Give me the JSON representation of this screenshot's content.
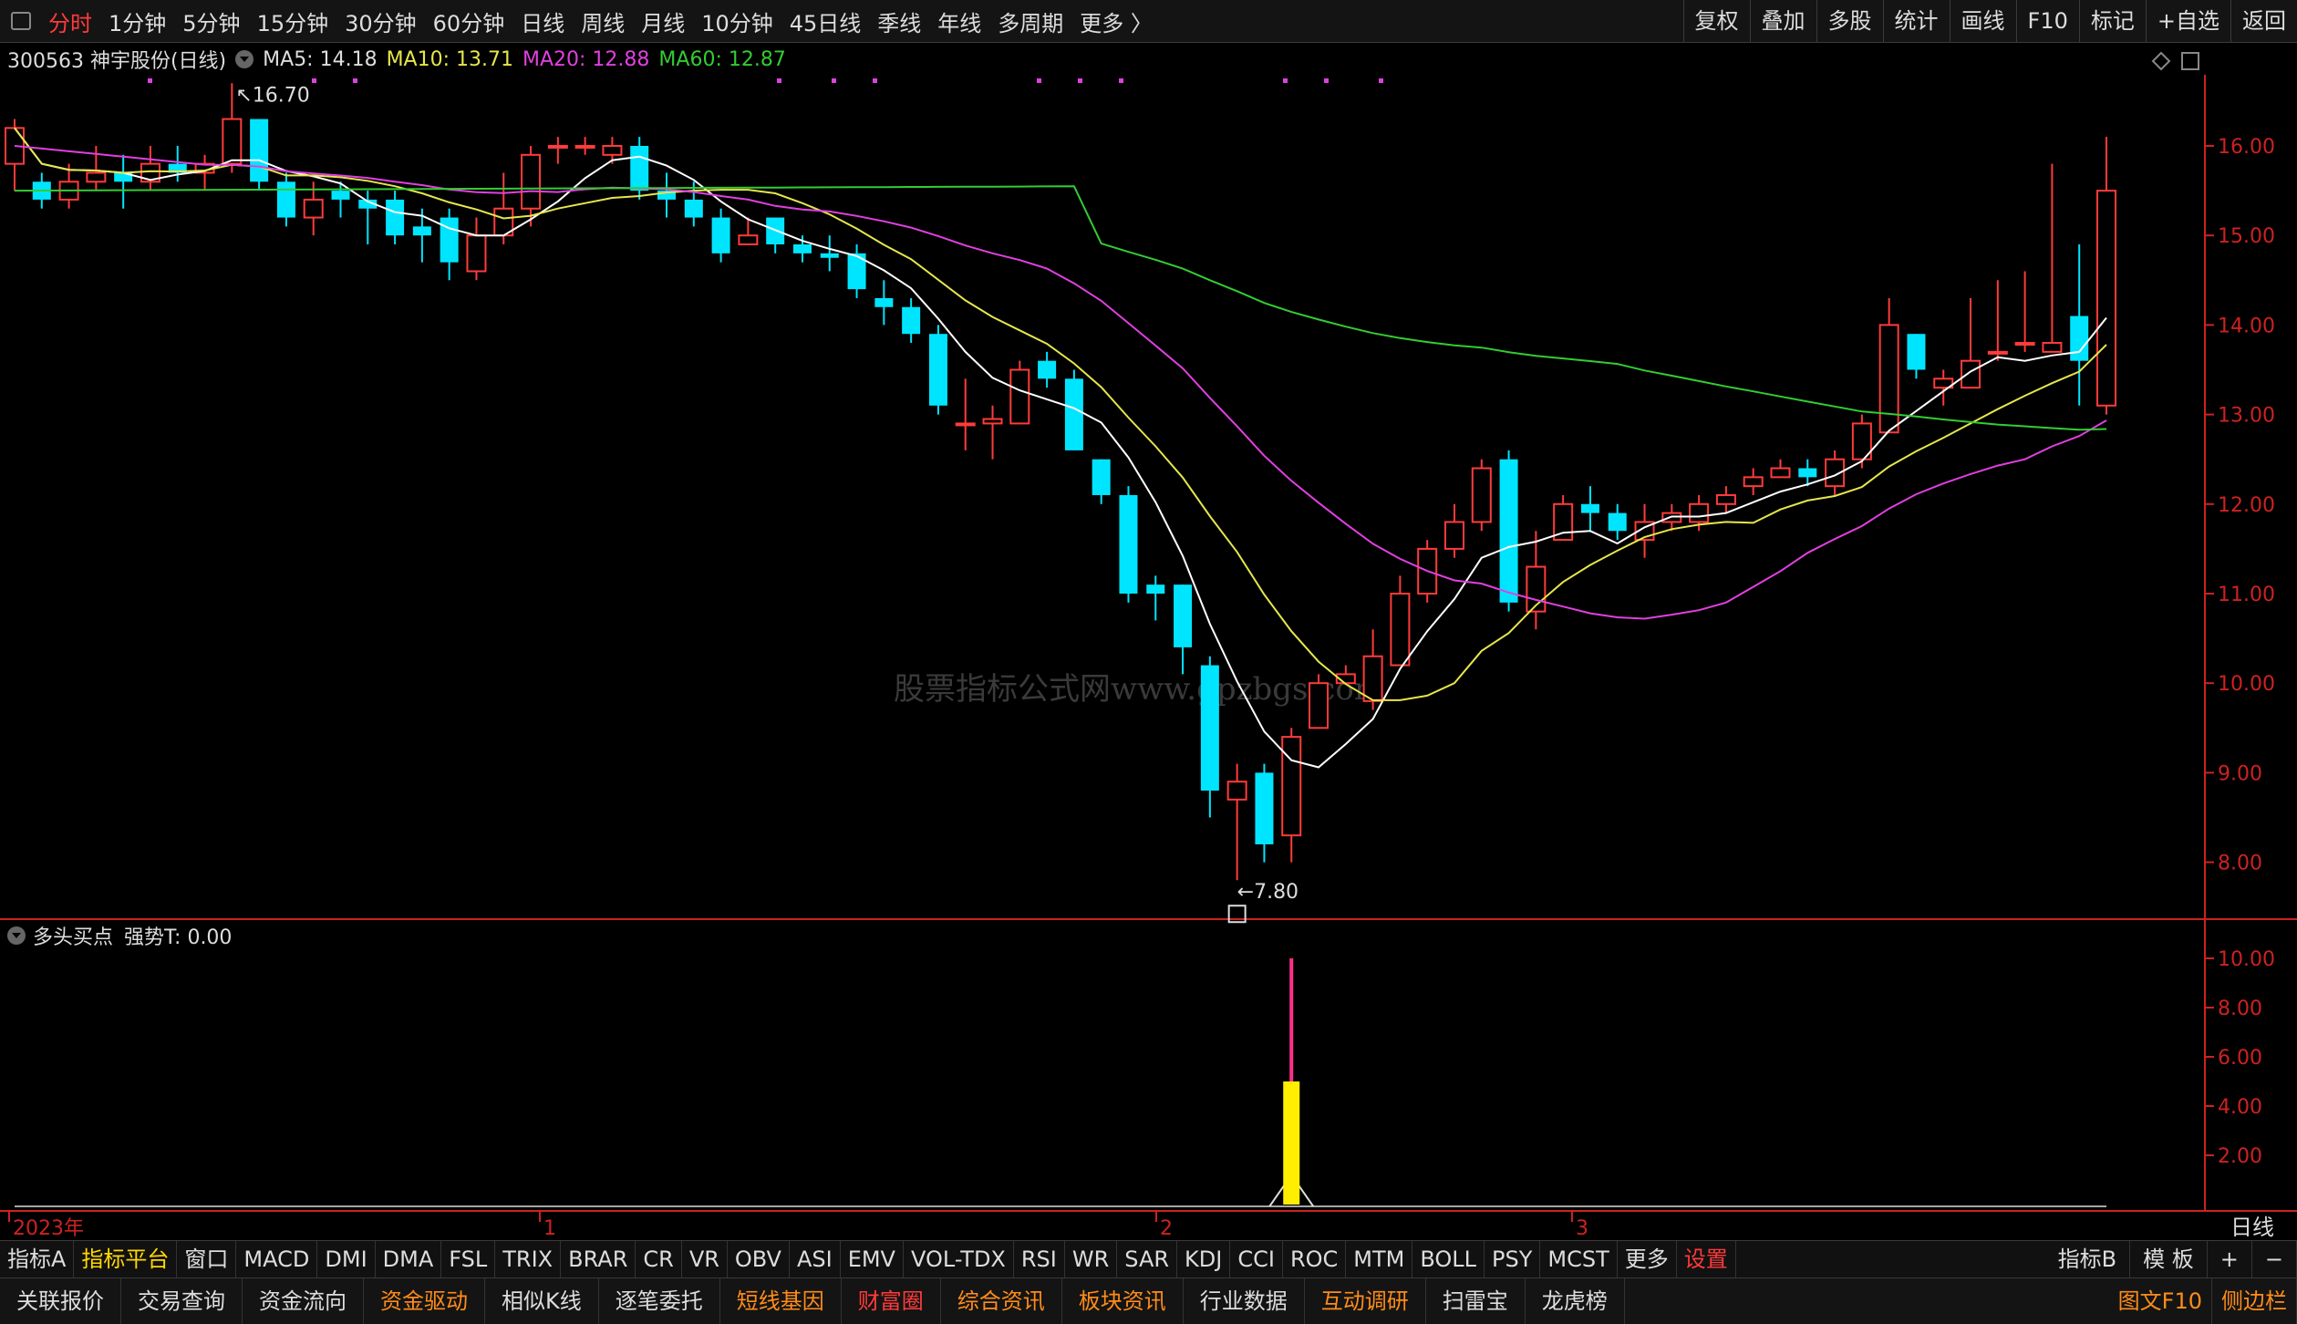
{
  "topbar": {
    "periods": [
      "分时",
      "1分钟",
      "5分钟",
      "15分钟",
      "30分钟",
      "60分钟",
      "日线",
      "周线",
      "月线",
      "10分钟",
      "45日线",
      "季线",
      "年线",
      "多周期",
      "更多 〉"
    ],
    "active_index": 0,
    "right_buttons": [
      "复权",
      "叠加",
      "多股",
      "统计",
      "画线",
      "F10",
      "标记",
      "+自选",
      "返回"
    ]
  },
  "info": {
    "stock": "300563 神宇股份(日线)",
    "ma5": "MA5: 14.18",
    "ma10": "MA10: 13.71",
    "ma20": "MA20: 12.88",
    "ma60": "MA60: 12.87"
  },
  "colors": {
    "up": "#ff3b3b",
    "down": "#00e5ff",
    "ma5": "#ffffff",
    "ma10": "#e6e64c",
    "ma20": "#e040e0",
    "ma60": "#33cc33",
    "axis": "#cc2222"
  },
  "annotations": {
    "high_label": "16.70",
    "low_label": "7.80"
  },
  "indicator": {
    "title": "多头买点",
    "value_label": "强势T: 0.00",
    "bar_value": 10,
    "bar_inner_value": 5
  },
  "watermark": "股票指标公式网www.gpzbgs.com",
  "time_labels": [
    "2023年",
    "1",
    "2",
    "3"
  ],
  "period_tag": "日线",
  "tabs": {
    "left": [
      "指标A",
      "指标平台",
      "窗口",
      "MACD",
      "DMI",
      "DMA",
      "FSL",
      "TRIX",
      "BRAR",
      "CR",
      "VR",
      "OBV",
      "ASI",
      "EMV",
      "VOL-TDX",
      "RSI",
      "WR",
      "SAR",
      "KDJ",
      "CCI",
      "ROC",
      "MTM",
      "BOLL",
      "PSY",
      "MCST",
      "更多",
      "设置"
    ],
    "right": [
      "指标B",
      "模 板",
      "+",
      "−"
    ]
  },
  "bottombar": {
    "buttons": [
      {
        "label": "关联报价",
        "style": ""
      },
      {
        "label": "交易查询",
        "style": ""
      },
      {
        "label": "资金流向",
        "style": ""
      },
      {
        "label": "资金驱动",
        "style": "orange"
      },
      {
        "label": "相似K线",
        "style": ""
      },
      {
        "label": "逐笔委托",
        "style": ""
      },
      {
        "label": "短线基因",
        "style": "orange"
      },
      {
        "label": "财富圈",
        "style": "red"
      },
      {
        "label": "综合资讯",
        "style": "orange"
      },
      {
        "label": "板块资讯",
        "style": "orange"
      },
      {
        "label": "行业数据",
        "style": ""
      },
      {
        "label": "互动调研",
        "style": "orange"
      },
      {
        "label": "扫雷宝",
        "style": ""
      },
      {
        "label": "龙虎榜",
        "style": ""
      }
    ],
    "right": [
      "图文F10",
      "侧边栏"
    ]
  },
  "chart_data": {
    "type": "candlestick",
    "y_axis": [
      16.0,
      15.0,
      14.0,
      13.0,
      12.0,
      11.0,
      10.0,
      9.0,
      8.0
    ],
    "ind_axis": [
      10.0,
      8.0,
      6.0,
      4.0,
      2.0
    ],
    "candles": [
      [
        15.8,
        16.2,
        16.3,
        15.5
      ],
      [
        15.6,
        15.4,
        15.7,
        15.3
      ],
      [
        15.4,
        15.6,
        15.8,
        15.3
      ],
      [
        15.6,
        15.7,
        16.0,
        15.5
      ],
      [
        15.7,
        15.6,
        15.9,
        15.3
      ],
      [
        15.6,
        15.8,
        16.0,
        15.5
      ],
      [
        15.8,
        15.7,
        16.0,
        15.6
      ],
      [
        15.7,
        15.8,
        15.9,
        15.5
      ],
      [
        15.8,
        16.3,
        16.7,
        15.7
      ],
      [
        16.3,
        15.6,
        16.3,
        15.5
      ],
      [
        15.6,
        15.2,
        15.7,
        15.1
      ],
      [
        15.2,
        15.4,
        15.6,
        15.0
      ],
      [
        15.5,
        15.4,
        15.6,
        15.2
      ],
      [
        15.4,
        15.3,
        15.5,
        14.9
      ],
      [
        15.4,
        15.0,
        15.5,
        14.9
      ],
      [
        15.1,
        15.0,
        15.3,
        14.7
      ],
      [
        15.2,
        14.7,
        15.3,
        14.5
      ],
      [
        14.6,
        15.0,
        15.2,
        14.5
      ],
      [
        15.0,
        15.3,
        15.7,
        14.9
      ],
      [
        15.3,
        15.9,
        16.0,
        15.1
      ],
      [
        16.0,
        16.0,
        16.1,
        15.8
      ],
      [
        16.0,
        16.0,
        16.1,
        15.9
      ],
      [
        15.9,
        16.0,
        16.1,
        15.8
      ],
      [
        16.0,
        15.5,
        16.1,
        15.4
      ],
      [
        15.5,
        15.4,
        15.7,
        15.2
      ],
      [
        15.4,
        15.2,
        15.6,
        15.1
      ],
      [
        15.2,
        14.8,
        15.3,
        14.7
      ],
      [
        14.9,
        15.0,
        15.2,
        14.9
      ],
      [
        15.2,
        14.9,
        15.2,
        14.8
      ],
      [
        14.9,
        14.8,
        15.0,
        14.7
      ],
      [
        14.8,
        14.75,
        15.0,
        14.6
      ],
      [
        14.8,
        14.4,
        14.9,
        14.3
      ],
      [
        14.3,
        14.2,
        14.5,
        14.0
      ],
      [
        14.2,
        13.9,
        14.3,
        13.8
      ],
      [
        13.9,
        13.1,
        14.0,
        13.0
      ],
      [
        12.9,
        12.9,
        13.4,
        12.6
      ],
      [
        12.9,
        12.95,
        13.1,
        12.5
      ],
      [
        12.9,
        13.5,
        13.6,
        12.9
      ],
      [
        13.6,
        13.4,
        13.7,
        13.3
      ],
      [
        13.4,
        12.6,
        13.5,
        12.6
      ],
      [
        12.5,
        12.1,
        12.5,
        12.0
      ],
      [
        12.1,
        11.0,
        12.2,
        10.9
      ],
      [
        11.1,
        11.0,
        11.2,
        10.7
      ],
      [
        11.1,
        10.4,
        11.1,
        10.1
      ],
      [
        10.2,
        8.8,
        10.3,
        8.5
      ],
      [
        8.7,
        8.9,
        9.1,
        7.8
      ],
      [
        9.0,
        8.2,
        9.1,
        8.0
      ],
      [
        8.3,
        9.4,
        9.5,
        8.0
      ],
      [
        9.5,
        10.0,
        10.1,
        9.5
      ],
      [
        10.0,
        10.1,
        10.2,
        10.0
      ],
      [
        9.8,
        10.3,
        10.6,
        9.7
      ],
      [
        10.2,
        11.0,
        11.2,
        10.2
      ],
      [
        11.0,
        11.5,
        11.6,
        10.9
      ],
      [
        11.5,
        11.8,
        12.0,
        11.4
      ],
      [
        11.8,
        12.4,
        12.5,
        11.7
      ],
      [
        12.5,
        10.9,
        12.6,
        10.8
      ],
      [
        10.8,
        11.3,
        11.7,
        10.6
      ],
      [
        11.6,
        12.0,
        12.1,
        11.6
      ],
      [
        12.0,
        11.9,
        12.2,
        11.7
      ],
      [
        11.9,
        11.7,
        12.0,
        11.6
      ],
      [
        11.6,
        11.8,
        12.0,
        11.4
      ],
      [
        11.8,
        11.9,
        12.0,
        11.7
      ],
      [
        11.8,
        12.0,
        12.1,
        11.7
      ],
      [
        12.0,
        12.1,
        12.2,
        11.9
      ],
      [
        12.2,
        12.3,
        12.4,
        12.1
      ],
      [
        12.3,
        12.4,
        12.5,
        12.3
      ],
      [
        12.4,
        12.3,
        12.5,
        12.2
      ],
      [
        12.2,
        12.5,
        12.6,
        12.1
      ],
      [
        12.5,
        12.9,
        13.0,
        12.4
      ],
      [
        12.8,
        14.0,
        14.3,
        12.8
      ],
      [
        13.9,
        13.5,
        13.9,
        13.4
      ],
      [
        13.3,
        13.4,
        13.5,
        13.1
      ],
      [
        13.3,
        13.6,
        14.3,
        13.3
      ],
      [
        13.7,
        13.7,
        14.5,
        13.6
      ],
      [
        13.8,
        13.8,
        14.6,
        13.7
      ],
      [
        13.7,
        13.8,
        15.8,
        13.7
      ],
      [
        14.1,
        13.6,
        14.9,
        13.1
      ],
      [
        13.1,
        15.5,
        16.1,
        13.0
      ]
    ]
  }
}
